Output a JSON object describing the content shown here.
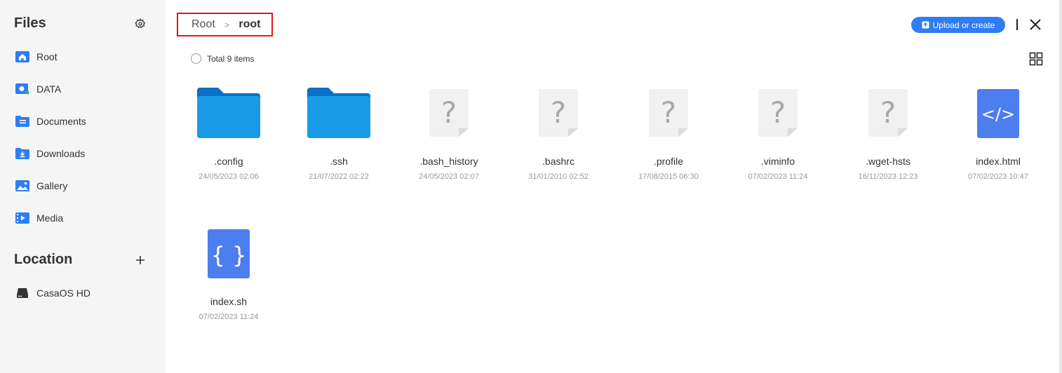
{
  "sidebar": {
    "title": "Files",
    "items": [
      {
        "label": "Root",
        "icon": "home-icon"
      },
      {
        "label": "DATA",
        "icon": "data-folder-icon"
      },
      {
        "label": "Documents",
        "icon": "documents-folder-icon"
      },
      {
        "label": "Downloads",
        "icon": "downloads-folder-icon"
      },
      {
        "label": "Gallery",
        "icon": "gallery-icon"
      },
      {
        "label": "Media",
        "icon": "media-icon"
      }
    ],
    "location_title": "Location",
    "locations": [
      {
        "label": "CasaOS HD",
        "icon": "drive-icon"
      }
    ]
  },
  "breadcrumb": {
    "root": "Root",
    "separator": ">",
    "current": "root"
  },
  "toolbar": {
    "upload_label": "Upload or create"
  },
  "listing": {
    "total_label": "Total 9 items"
  },
  "files": [
    {
      "name": ".config",
      "date": "24/05/2023 02:06",
      "type": "folder"
    },
    {
      "name": ".ssh",
      "date": "21/07/2022 02:22",
      "type": "folder"
    },
    {
      "name": ".bash_history",
      "date": "24/05/2023 02:07",
      "type": "unknown"
    },
    {
      "name": ".bashrc",
      "date": "31/01/2010 02:52",
      "type": "unknown"
    },
    {
      "name": ".profile",
      "date": "17/08/2015 06:30",
      "type": "unknown"
    },
    {
      "name": ".viminfo",
      "date": "07/02/2023 11:24",
      "type": "unknown"
    },
    {
      "name": ".wget-hsts",
      "date": "16/11/2023 12:23",
      "type": "unknown"
    },
    {
      "name": "index.html",
      "date": "07/02/2023 10:47",
      "type": "html"
    },
    {
      "name": "index.sh",
      "date": "07/02/2023 11:24",
      "type": "script"
    }
  ],
  "colors": {
    "accent": "#2f7df5",
    "highlight": "#e0141e",
    "sidebar_bg": "#f5f5f5",
    "folder": "#1a8fe0",
    "code_tile": "#4d7ef0"
  }
}
